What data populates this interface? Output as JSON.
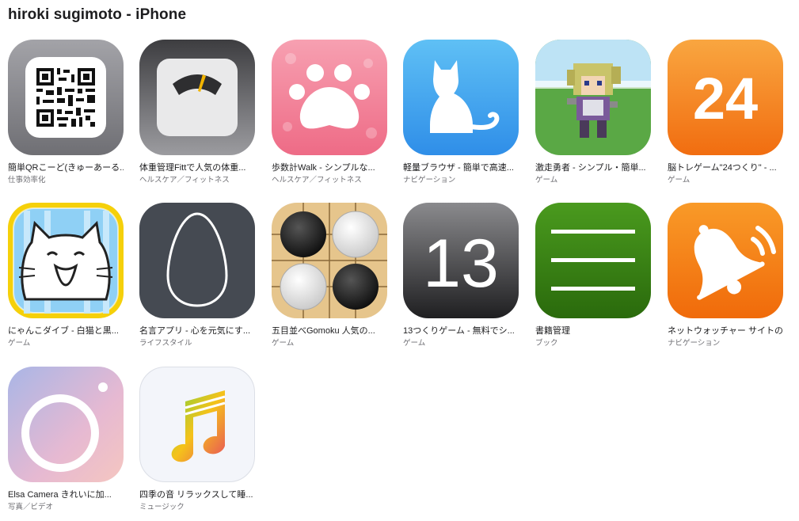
{
  "header": {
    "title": "hiroki sugimoto - iPhone"
  },
  "apps": [
    {
      "name": "簡単QRこーど(きゅーあーる...",
      "category": "仕事効率化",
      "icon": "qr-code-icon"
    },
    {
      "name": "体重管理Fittで人気の体重...",
      "category": "ヘルスケア／フィットネス",
      "icon": "scale-icon"
    },
    {
      "name": "歩数計Walk - シンプルな...",
      "category": "ヘルスケア／フィットネス",
      "icon": "paw-icon"
    },
    {
      "name": "軽量ブラウザ - 簡単で高速...",
      "category": "ナビゲーション",
      "icon": "cat-silhouette-icon"
    },
    {
      "name": "激走勇者 - シンプル・簡単...",
      "category": "ゲーム",
      "icon": "pixel-hero-icon"
    },
    {
      "name": "脳トレゲーム\"24つくり\" - ...",
      "category": "ゲーム",
      "icon": "number-24-icon",
      "glyph": "24"
    },
    {
      "name": "にゃんこダイブ - 白猫と黒...",
      "category": "ゲーム",
      "icon": "cartoon-cat-icon"
    },
    {
      "name": "名言アプリ - 心を元気にす...",
      "category": "ライフスタイル",
      "icon": "egg-outline-icon"
    },
    {
      "name": "五目並べGomoku 人気の...",
      "category": "ゲーム",
      "icon": "go-stones-icon"
    },
    {
      "name": "13つくりゲーム - 無料でシ...",
      "category": "ゲーム",
      "icon": "number-13-icon",
      "glyph": "13"
    },
    {
      "name": "書籍管理",
      "category": "ブック",
      "icon": "three-lines-icon"
    },
    {
      "name": "ネットウォッチャー サイトの...",
      "category": "ナビゲーション",
      "icon": "bell-icon"
    },
    {
      "name": "Elsa Camera きれいに加...",
      "category": "写真／ビデオ",
      "icon": "camera-ring-icon"
    },
    {
      "name": "四季の音 リラックスして睡...",
      "category": "ミュージック",
      "icon": "music-note-icon"
    }
  ]
}
